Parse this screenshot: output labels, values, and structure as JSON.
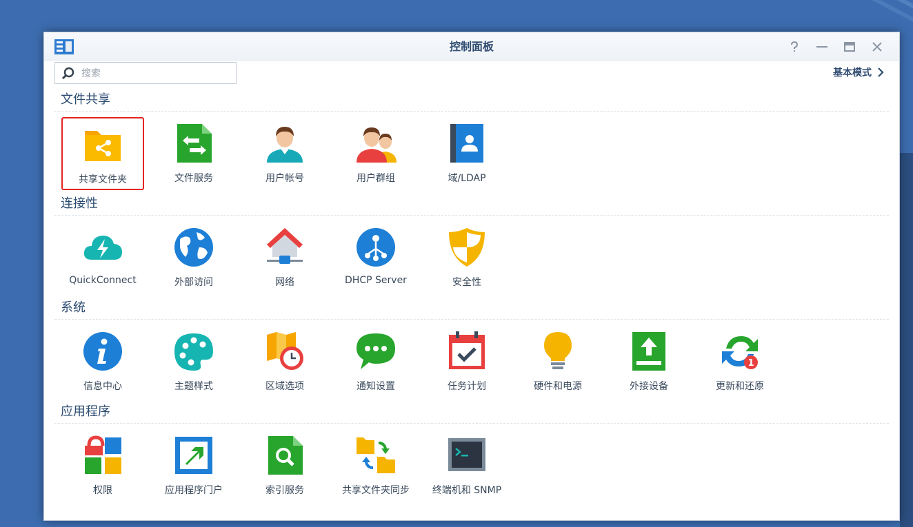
{
  "window": {
    "title": "控制面板"
  },
  "search": {
    "placeholder": "搜索"
  },
  "header": {
    "basic_mode_label": "基本模式"
  },
  "icons": {
    "window_controls": [
      "help-icon",
      "minimize-icon",
      "maximize-icon",
      "close-icon"
    ]
  },
  "sections": [
    {
      "title": "文件共享",
      "items": [
        {
          "label": "共享文件夹",
          "icon": "shared-folder-icon",
          "selected": true
        },
        {
          "label": "文件服务",
          "icon": "file-services-icon"
        },
        {
          "label": "用户帐号",
          "icon": "user-icon"
        },
        {
          "label": "用户群组",
          "icon": "group-icon"
        },
        {
          "label": "域/LDAP",
          "icon": "domain-ldap-icon"
        }
      ]
    },
    {
      "title": "连接性",
      "items": [
        {
          "label": "QuickConnect",
          "icon": "quickconnect-icon"
        },
        {
          "label": "外部访问",
          "icon": "globe-icon"
        },
        {
          "label": "网络",
          "icon": "network-house-icon"
        },
        {
          "label": "DHCP Server",
          "icon": "dhcp-icon"
        },
        {
          "label": "安全性",
          "icon": "shield-icon"
        }
      ]
    },
    {
      "title": "系统",
      "items": [
        {
          "label": "信息中心",
          "icon": "info-icon"
        },
        {
          "label": "主题样式",
          "icon": "palette-icon"
        },
        {
          "label": "区域选项",
          "icon": "regional-clock-icon"
        },
        {
          "label": "通知设置",
          "icon": "chat-bubble-icon"
        },
        {
          "label": "任务计划",
          "icon": "calendar-check-icon"
        },
        {
          "label": "硬件和电源",
          "icon": "lightbulb-icon"
        },
        {
          "label": "外接设备",
          "icon": "external-device-icon"
        },
        {
          "label": "更新和还原",
          "icon": "update-restore-icon",
          "badge": "1"
        }
      ]
    },
    {
      "title": "应用程序",
      "items": [
        {
          "label": "权限",
          "icon": "privileges-icon"
        },
        {
          "label": "应用程序门户",
          "icon": "app-portal-icon"
        },
        {
          "label": "索引服务",
          "icon": "search-index-icon"
        },
        {
          "label": "共享文件夹同步",
          "icon": "folder-sync-icon"
        },
        {
          "label": "终端机和 SNMP",
          "icon": "terminal-icon"
        }
      ]
    }
  ],
  "colors": {
    "accent": "#2f4b70",
    "selection": "#e4251f",
    "desktop": "#3d6db0"
  }
}
